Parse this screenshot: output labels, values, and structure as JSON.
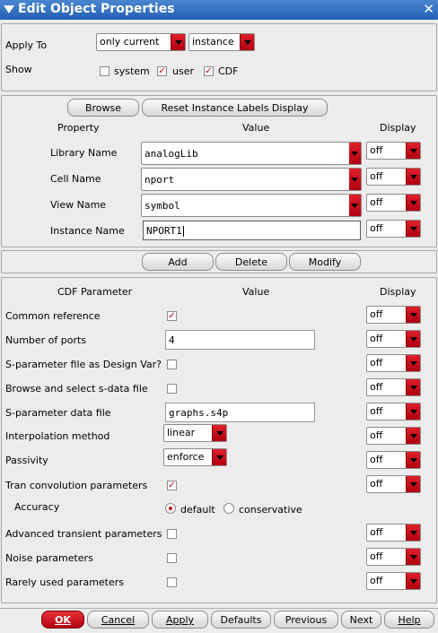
{
  "window": {
    "title": "Edit Object Properties"
  },
  "apply": {
    "apply_to_label": "Apply To",
    "apply_to_value": "only current",
    "apply_target_value": "instance",
    "show_label": "Show",
    "show_options": [
      {
        "label": "system",
        "checked": false
      },
      {
        "label": "user",
        "checked": true
      },
      {
        "label": "CDF",
        "checked": true
      }
    ]
  },
  "instance": {
    "browse_label": "Browse",
    "reset_label": "Reset Instance Labels Display",
    "col_property": "Property",
    "col_value": "Value",
    "col_display": "Display",
    "rows": [
      {
        "label": "Library Name",
        "value": "analogLib",
        "display": "off"
      },
      {
        "label": "Cell Name",
        "value": "nport",
        "display": "off"
      },
      {
        "label": "View Name",
        "value": "symbol",
        "display": "off"
      },
      {
        "label": "Instance Name",
        "value": "NPORT1",
        "display": "off"
      }
    ]
  },
  "actions": {
    "add": "Add",
    "delete": "Delete",
    "modify": "Modify"
  },
  "cdf": {
    "col_param": "CDF Parameter",
    "col_value": "Value",
    "col_display": "Display",
    "rows": [
      {
        "label": "Common reference",
        "checked": true,
        "display": "off"
      },
      {
        "label": "Number of ports",
        "value": "4",
        "display": "off"
      },
      {
        "label": "S-parameter file as Design Var?",
        "checked": false,
        "display": "off"
      },
      {
        "label": "Browse and select s-data file",
        "checked": false,
        "display": "off"
      },
      {
        "label": "S-parameter data file",
        "value": "graphs.s4p",
        "display": "off"
      },
      {
        "label": "Interpolation method",
        "select": "linear",
        "display": "off"
      },
      {
        "label": "Passivity",
        "select": "enforce",
        "display": "off"
      },
      {
        "label": "Tran convolution parameters",
        "checked": true,
        "display": "off"
      },
      {
        "label": "Accuracy",
        "radio_default": "default",
        "radio_conservative": "conservative",
        "selected": "default"
      },
      {
        "label": "Advanced transient parameters",
        "checked": false,
        "display": "off"
      },
      {
        "label": "Noise parameters",
        "checked": false,
        "display": "off"
      },
      {
        "label": "Rarely used parameters",
        "checked": false,
        "display": "off"
      }
    ]
  },
  "footer": {
    "ok": "OK",
    "cancel": "Cancel",
    "apply": "Apply",
    "defaults": "Defaults",
    "previous": "Previous",
    "next": "Next",
    "help": "Help"
  },
  "colors": {
    "title_bar": "#2f6fc4",
    "accent_red": "#c00010"
  }
}
